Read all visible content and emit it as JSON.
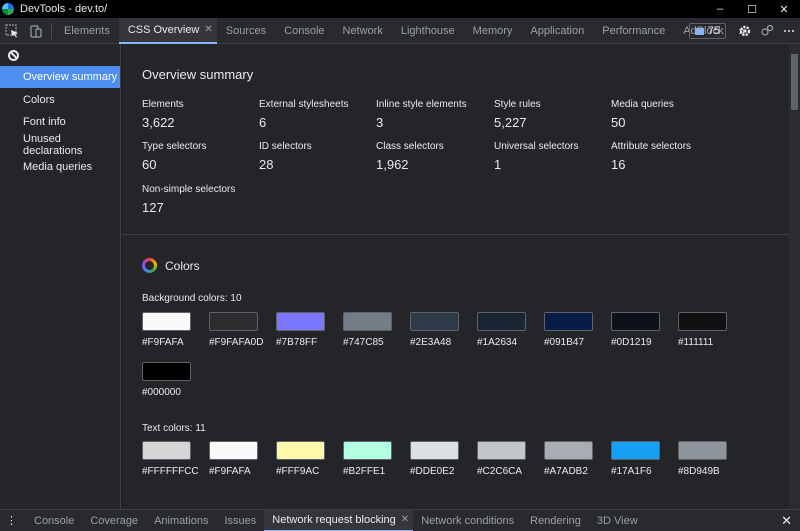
{
  "window": {
    "title": "DevTools - dev.to/",
    "controls": [
      "–",
      "☐",
      "✕"
    ]
  },
  "tabs": [
    {
      "label": "Elements",
      "active": false
    },
    {
      "label": "CSS Overview",
      "active": true
    },
    {
      "label": "Sources",
      "active": false
    },
    {
      "label": "Console",
      "active": false
    },
    {
      "label": "Network",
      "active": false
    },
    {
      "label": "Lighthouse",
      "active": false
    },
    {
      "label": "Memory",
      "active": false
    },
    {
      "label": "Application",
      "active": false
    },
    {
      "label": "Performance",
      "active": false
    },
    {
      "label": "AdBlock",
      "active": false
    }
  ],
  "tabbar": {
    "more": "»",
    "issues_count": "75",
    "close_glyph": "✕"
  },
  "sidebar": {
    "items": [
      {
        "label": "Overview summary",
        "active": true
      },
      {
        "label": "Colors",
        "active": false
      },
      {
        "label": "Font info",
        "active": false
      },
      {
        "label": "Unused declarations",
        "active": false
      },
      {
        "label": "Media queries",
        "active": false
      }
    ]
  },
  "overview": {
    "title": "Overview summary",
    "stats": [
      {
        "label": "Elements",
        "value": "3,622"
      },
      {
        "label": "External stylesheets",
        "value": "6"
      },
      {
        "label": "Inline style elements",
        "value": "3"
      },
      {
        "label": "Style rules",
        "value": "5,227"
      },
      {
        "label": "Media queries",
        "value": "50"
      },
      {
        "label": "Type selectors",
        "value": "60"
      },
      {
        "label": "ID selectors",
        "value": "28"
      },
      {
        "label": "Class selectors",
        "value": "1,962"
      },
      {
        "label": "Universal selectors",
        "value": "1"
      },
      {
        "label": "Attribute selectors",
        "value": "16"
      },
      {
        "label": "Non-simple selectors",
        "value": "127"
      }
    ]
  },
  "colors": {
    "title": "Colors",
    "background": {
      "label": "Background colors: 10",
      "swatches": [
        {
          "hex": "#F9FAFA",
          "color": "#F9FAFA"
        },
        {
          "hex": "#F9FAFA0D",
          "color": "#2c2d2f"
        },
        {
          "hex": "#7B78FF",
          "color": "#7B78FF"
        },
        {
          "hex": "#747C85",
          "color": "#747C85"
        },
        {
          "hex": "#2E3A48",
          "color": "#2E3A48"
        },
        {
          "hex": "#1A2634",
          "color": "#1A2634"
        },
        {
          "hex": "#091B47",
          "color": "#091B47"
        },
        {
          "hex": "#0D1219",
          "color": "#0D1219"
        },
        {
          "hex": "#111111",
          "color": "#111111"
        },
        {
          "hex": "#000000",
          "color": "#000000"
        }
      ]
    },
    "text": {
      "label": "Text colors: 11",
      "swatches": [
        {
          "hex": "#FFFFFFCC",
          "color": "#d6d6d7"
        },
        {
          "hex": "#F9FAFA",
          "color": "#F9FAFA"
        },
        {
          "hex": "#FFF9AC",
          "color": "#FFF9AC"
        },
        {
          "hex": "#B2FFE1",
          "color": "#B2FFE1"
        },
        {
          "hex": "#DDE0E2",
          "color": "#DDE0E2"
        },
        {
          "hex": "#C2C6CA",
          "color": "#C2C6CA"
        },
        {
          "hex": "#A7ADB2",
          "color": "#A7ADB2"
        },
        {
          "hex": "#17A1F6",
          "color": "#17A1F6"
        },
        {
          "hex": "#8D949B",
          "color": "#8D949B"
        }
      ]
    }
  },
  "drawer": {
    "more": "⋮",
    "tabs": [
      {
        "label": "Console",
        "active": false
      },
      {
        "label": "Coverage",
        "active": false
      },
      {
        "label": "Animations",
        "active": false
      },
      {
        "label": "Issues",
        "active": false
      },
      {
        "label": "Network request blocking",
        "active": true
      },
      {
        "label": "Network conditions",
        "active": false
      },
      {
        "label": "Rendering",
        "active": false
      },
      {
        "label": "3D View",
        "active": false
      }
    ],
    "close": "✕"
  }
}
